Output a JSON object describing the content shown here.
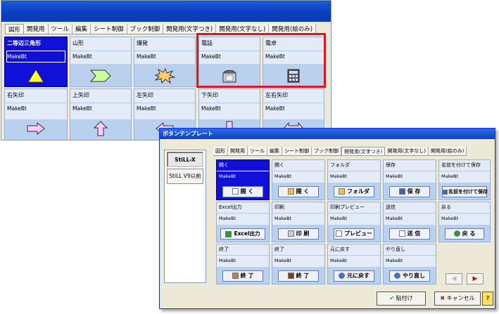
{
  "back_window": {
    "tabs": [
      "図形",
      "開発用",
      "ツール",
      "編集",
      "シート制御",
      "ブック制御",
      "開発用(文字つき)",
      "開発用(文字なし)",
      "開発用(絵のみ)"
    ],
    "cells_row1": [
      {
        "name": "二等辺三角形",
        "make": "MakeBt"
      },
      {
        "name": "山形",
        "make": "MakeBt"
      },
      {
        "name": "爆発",
        "make": "MakeBt"
      },
      {
        "name": "電話",
        "make": "MakeBt"
      },
      {
        "name": "電卓",
        "make": "MakeBt"
      }
    ],
    "cells_row2": [
      {
        "name": "右矢印",
        "make": "MakeBt"
      },
      {
        "name": "上矢印",
        "make": "MakeBt"
      },
      {
        "name": "左矢印",
        "make": "MakeBt"
      },
      {
        "name": "下矢印",
        "make": "MakeBt"
      },
      {
        "name": "左右矢印",
        "make": "MakeBt"
      }
    ]
  },
  "dialog": {
    "title": "ボタンテンプレート",
    "side_buttons": [
      "StiLL-X",
      "StiLL V9以前"
    ],
    "tabs": [
      "図形",
      "開発用",
      "ツール",
      "編集",
      "シート制御",
      "ブック制御",
      "開発用(文字つき)",
      "開発用(文字なし)",
      "開発用(絵のみ)"
    ],
    "cells": [
      {
        "name": "開く",
        "make": "MakeBt",
        "btn": "開 く"
      },
      {
        "name": "開く",
        "make": "MakeBt",
        "btn": "開 く"
      },
      {
        "name": "フォルダ",
        "make": "MakeBt",
        "btn": "フォルダ"
      },
      {
        "name": "保存",
        "make": "MakeBt",
        "btn": "保 存"
      },
      {
        "name": "名前を付けて保存",
        "make": "MakeBt",
        "btn": "名前を付けて保存"
      },
      {
        "name": "Excel出力",
        "make": "MakeBt",
        "btn": "Excel出力"
      },
      {
        "name": "印刷",
        "make": "MakeBt",
        "btn": "印 刷"
      },
      {
        "name": "印刷プレビュー",
        "make": "MakeBt",
        "btn": "プレビュー"
      },
      {
        "name": "送信",
        "make": "MakeBt",
        "btn": "送 信"
      },
      {
        "name": "戻る",
        "make": "MakeBt",
        "btn": "戻 る"
      },
      {
        "name": "終了",
        "make": "MakeBt",
        "btn": "終 了"
      },
      {
        "name": "終了",
        "make": "MakeBt",
        "btn": "終 了"
      },
      {
        "name": "元に戻す",
        "make": "MakeBt",
        "btn": "元に戻す"
      },
      {
        "name": "やり直し",
        "make": "MakeBt",
        "btn": "やり直し"
      }
    ],
    "ok_label": "貼付け",
    "cancel_label": "キャンセル",
    "help_label": "?"
  },
  "colors": {
    "selected": "#1010d8",
    "highlight_frame": "#e0141e",
    "band": "#b9d0ee"
  }
}
